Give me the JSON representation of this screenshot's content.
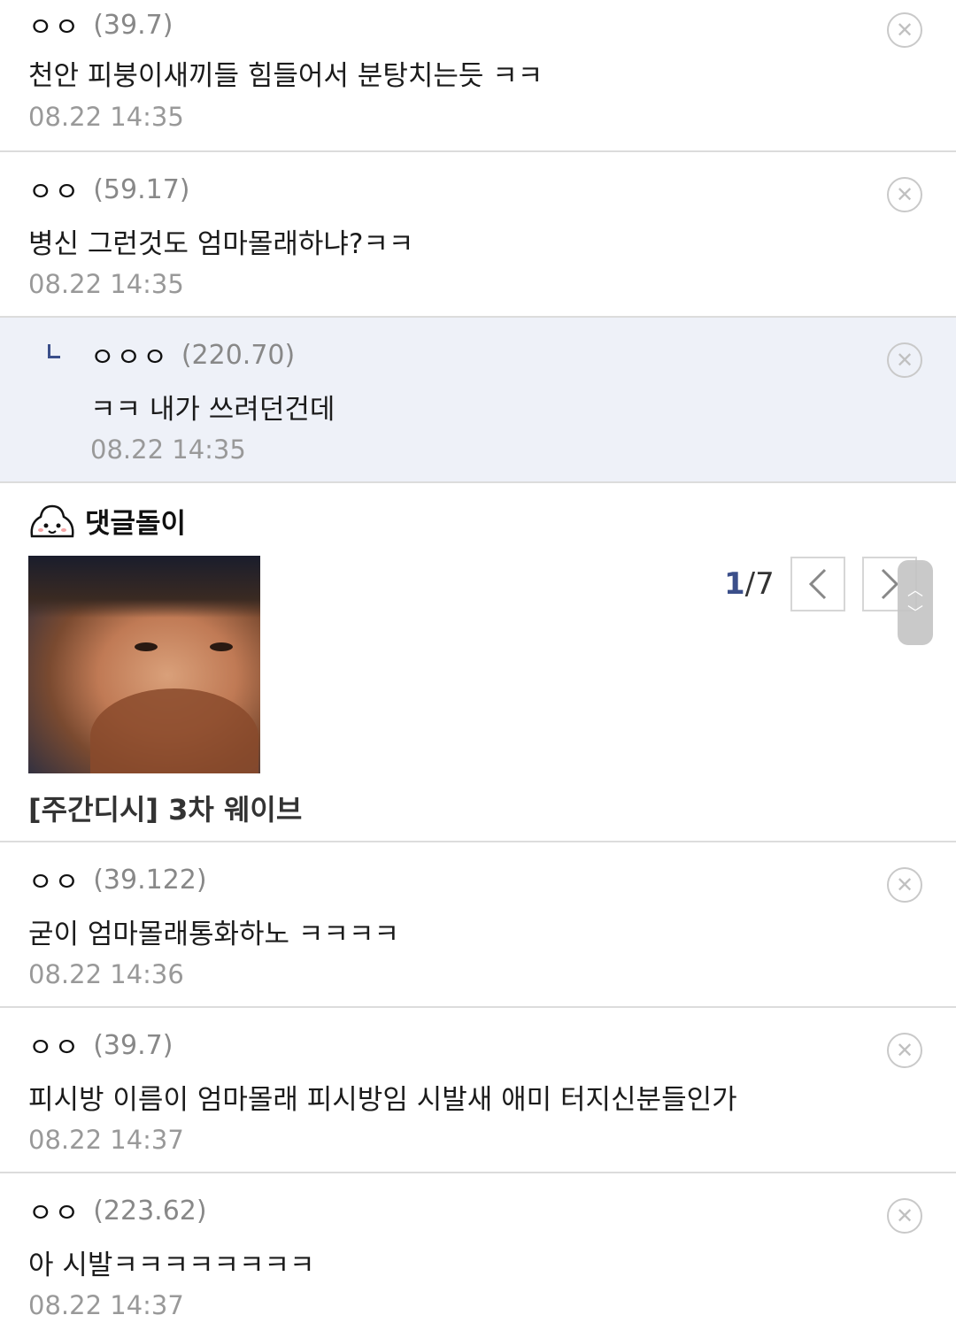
{
  "comments": [
    {
      "nick": "ㅇㅇ",
      "ip": "(39.7)",
      "text": "천안 피붕이새끼들 힘들어서 분탕치는듯 ㅋㅋ",
      "time": "08.22 14:35"
    },
    {
      "nick": "ㅇㅇ",
      "ip": "(59.17)",
      "text": "병신 그런것도 엄마몰래하냐?ㅋㅋ",
      "time": "08.22 14:35"
    },
    {
      "nick": "ㅇㅇㅇ",
      "ip": "(220.70)",
      "text": "ㅋㅋ 내가 쓰려던건데",
      "time": "08.22 14:35"
    },
    {
      "nick": "ㅇㅇ",
      "ip": "(39.122)",
      "text": "굳이 엄마몰래통화하노 ㅋㅋㅋㅋ",
      "time": "08.22 14:36"
    },
    {
      "nick": "ㅇㅇ",
      "ip": "(39.7)",
      "text": "피시방 이름이 엄마몰래 피시방임 시발새 애미 터지신분들인가",
      "time": "08.22 14:37"
    },
    {
      "nick": "ㅇㅇ",
      "ip": "(223.62)",
      "text": "아 시발ㅋㅋㅋㅋㅋㅋㅋㅋ",
      "time": "08.22 14:37"
    }
  ],
  "bot": {
    "name": "댓글돌이",
    "title": "[주간디시] 3차 웨이브",
    "page_current": "1",
    "page_total": "/7",
    "prev_icon": "chevron-left-icon",
    "next_icon": "chevron-right-icon"
  },
  "delete_icon": "close-circle-icon",
  "colors": {
    "accent": "#3b4f8a",
    "reply_bg": "#eef1f8",
    "muted": "#999999"
  }
}
